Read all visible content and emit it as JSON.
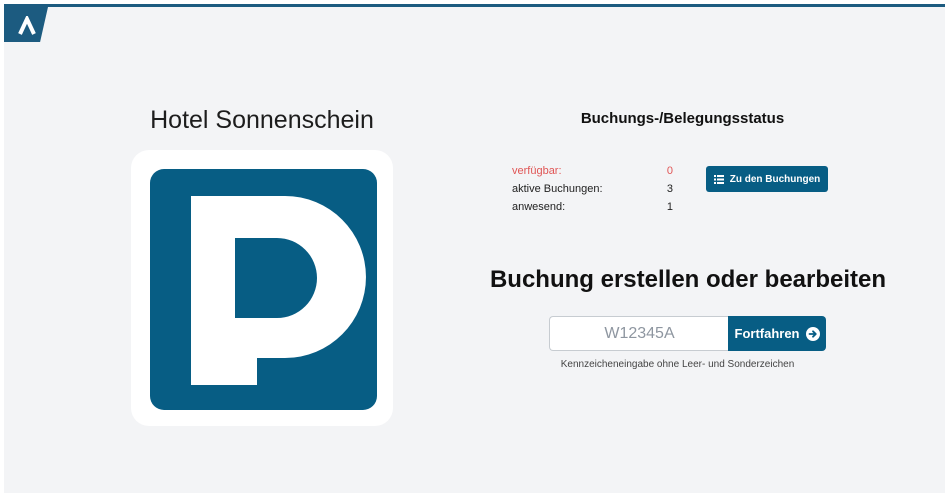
{
  "app": {
    "logo_icon": "brand-a-logo-icon",
    "accent_color": "#075d84"
  },
  "hotel": {
    "name": "Hotel Sonnenschein",
    "image_icon": "parking-sign-icon"
  },
  "status": {
    "title": "Buchungs-/Belegungsstatus",
    "rows": [
      {
        "label": "verfügbar:",
        "value": "0",
        "color": "#e05555"
      },
      {
        "label": "aktive Buchungen:",
        "value": "3"
      },
      {
        "label": "anwesend:",
        "value": "1"
      }
    ],
    "button": {
      "label": "Zu den Buchungen",
      "icon": "list-icon"
    }
  },
  "booking": {
    "title": "Buchung erstellen oder bearbeiten",
    "input_placeholder": "W12345A",
    "input_value": "",
    "button_label": "Fortfahren",
    "button_icon": "arrow-right-circle-icon",
    "hint": "Kennzeicheneingabe ohne Leer- und Sonderzeichen"
  }
}
